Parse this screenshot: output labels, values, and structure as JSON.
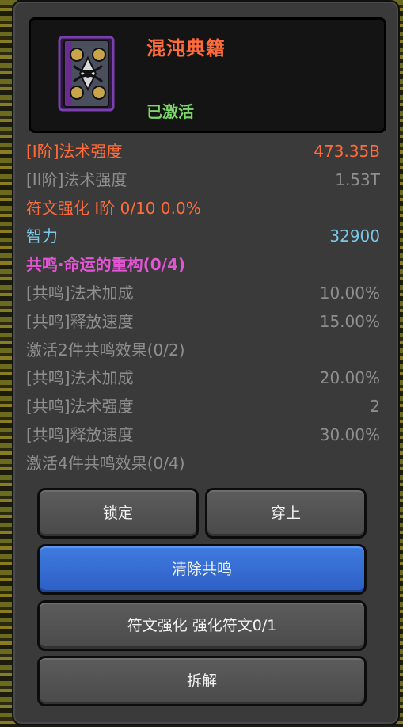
{
  "item": {
    "name": "混沌典籍",
    "status": "已激活",
    "icon": "chaos-tome-icon"
  },
  "stats": [
    {
      "label": "[I阶]法术强度",
      "value": "473.35B",
      "color": "#ff6b3a"
    },
    {
      "label": "[II阶]法术强度",
      "value": "1.53T",
      "color": "#8f8f8f"
    },
    {
      "label": "符文强化 I阶 0/10 0.0%",
      "value": "",
      "color": "#ff6b3a"
    },
    {
      "label": "智力",
      "value": "32900",
      "color": "#79c8e8"
    },
    {
      "label": "共鸣·命运的重构(0/4)",
      "value": "",
      "color": "#e455d6"
    },
    {
      "label": "[共鸣]法术加成",
      "value": "10.00%",
      "color": "#8f8f8f"
    },
    {
      "label": "[共鸣]释放速度",
      "value": "15.00%",
      "color": "#8f8f8f"
    },
    {
      "label": "激活2件共鸣效果(0/2)",
      "value": "",
      "color": "#8f8f8f"
    },
    {
      "label": "[共鸣]法术加成",
      "value": "20.00%",
      "color": "#8f8f8f"
    },
    {
      "label": "[共鸣]法术强度",
      "value": "2",
      "color": "#8f8f8f"
    },
    {
      "label": "[共鸣]释放速度",
      "value": "30.00%",
      "color": "#8f8f8f"
    },
    {
      "label": "激活4件共鸣效果(0/4)",
      "value": "",
      "color": "#8f8f8f"
    }
  ],
  "buttons": {
    "lock": "锁定",
    "equip": "穿上",
    "clear_resonance": "清除共鸣",
    "rune_enhance": "符文强化 强化符文0/1",
    "disassemble": "拆解"
  }
}
